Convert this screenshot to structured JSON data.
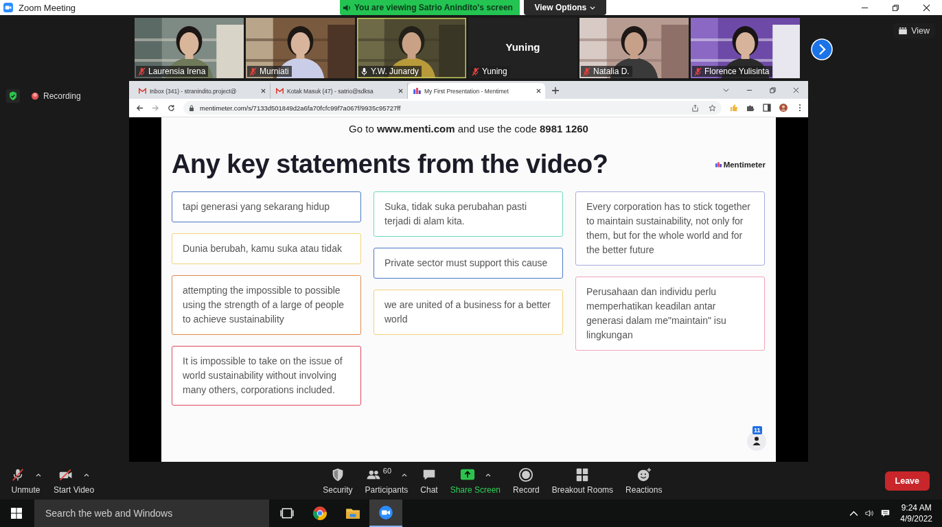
{
  "window": {
    "title": "Zoom Meeting"
  },
  "share_banner": {
    "text": "You are viewing Satrio Anindito's screen",
    "view_options": "View Options"
  },
  "participants": [
    {
      "name": "Laurensia Irena",
      "kind": "video",
      "muted": true,
      "speaking": false
    },
    {
      "name": "Murniati",
      "kind": "video",
      "muted": true,
      "speaking": false
    },
    {
      "name": "Y.W. Junardy",
      "kind": "video",
      "muted": false,
      "speaking": true
    },
    {
      "name": "Yuning",
      "kind": "name",
      "display_name": "Yuning",
      "muted": true,
      "speaking": false
    },
    {
      "name": "Natalia D.",
      "kind": "video",
      "muted": true,
      "speaking": false
    },
    {
      "name": "Florence Yulisinta",
      "kind": "video",
      "muted": true,
      "speaking": false
    }
  ],
  "view_button": "View",
  "recording": {
    "label": "Recording"
  },
  "browser": {
    "tabs": [
      {
        "title": "Inbox (341) - stranindito.project@",
        "kind": "gmail",
        "selected": false
      },
      {
        "title": "Kotak Masuk (47) - satrio@sdksa",
        "kind": "gmail",
        "selected": false
      },
      {
        "title": "My First Presentation - Mentimet",
        "kind": "menti",
        "selected": true
      }
    ],
    "url": "mentimeter.com/s/7133d501849d2a6fa70fcfc99f7a067f/9935c95727ff"
  },
  "slide": {
    "instruction": "Go to **www.menti.com** and use the code **8981 1260**",
    "title": "Any key statements from the video?",
    "brand": "Mentimeter",
    "columns": [
      [
        {
          "text": "tapi generasi yang sekarang hidup",
          "color": "#4a78c8"
        },
        {
          "text": "Dunia berubah, kamu suka atau tidak",
          "color": "#f2d27a"
        },
        {
          "text": "attempting the impossible to possible using the strength of a large of people to achieve sustainability",
          "color": "#e08a4a"
        },
        {
          "text": "It is impossible to take on the issue of world sustainability without involving many others, corporations included.",
          "color": "#e0485a"
        }
      ],
      [
        {
          "text": "Suka, tidak suka perubahan pasti terjadi di alam kita.",
          "color": "#6fd8bf"
        },
        {
          "text": "Private sector must support this cause",
          "color": "#4a78c8"
        },
        {
          "text": "we are united of a business for a better world",
          "color": "#f2d27a"
        }
      ],
      [
        {
          "text": "Every corporation has to stick together to maintain sustainability, not only for them, but for the whole world and for the better future",
          "color": "#a9a9e0"
        },
        {
          "text": "Perusahaan dan individu perlu memperhatikan keadilan antar generasi dalam me\"maintain\" isu lingkungan",
          "color": "#f0a3b6"
        }
      ]
    ],
    "participant_count": "11"
  },
  "toolbar": {
    "left": [
      {
        "label": "Unmute",
        "kind": "mic"
      },
      {
        "label": "Start Video",
        "kind": "video"
      }
    ],
    "center": [
      {
        "label": "Security",
        "kind": "security"
      },
      {
        "label": "Participants",
        "kind": "participants",
        "count": "60"
      },
      {
        "label": "Chat",
        "kind": "chat"
      },
      {
        "label": "Share Screen",
        "kind": "share"
      },
      {
        "label": "Record",
        "kind": "record"
      },
      {
        "label": "Breakout Rooms",
        "kind": "rooms"
      },
      {
        "label": "Reactions",
        "kind": "reactions"
      }
    ],
    "leave": "Leave"
  },
  "taskbar": {
    "search_placeholder": "Search the web and Windows",
    "apps": [
      {
        "kind": "taskview",
        "active": false
      },
      {
        "kind": "chrome",
        "active": false
      },
      {
        "kind": "files",
        "active": false
      },
      {
        "kind": "zoom",
        "active": true
      }
    ],
    "time": "9:24 AM",
    "date": "4/9/2022"
  }
}
